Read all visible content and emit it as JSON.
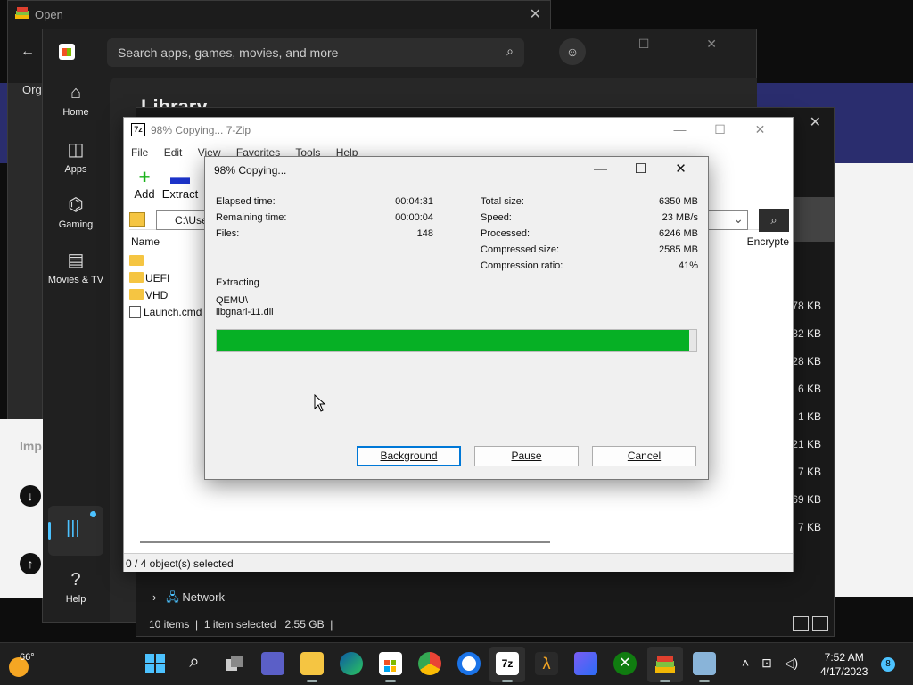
{
  "open_window": {
    "title": "Open",
    "org_label": "Orga"
  },
  "store": {
    "search_placeholder": "Search apps, games, movies, and more",
    "library_title": "Library",
    "nav": [
      {
        "label": "Home",
        "icon": "home-icon"
      },
      {
        "label": "Apps",
        "icon": "apps-icon"
      },
      {
        "label": "Gaming",
        "icon": "gaming-icon"
      },
      {
        "label": "Movies & TV",
        "icon": "movies-icon"
      },
      {
        "label": "Help",
        "icon": "help-icon"
      }
    ],
    "left_panel_label": "Imp"
  },
  "explorer": {
    "sizes": [
      "78 KB",
      "82 KB",
      "28 KB",
      "6 KB",
      "1 KB",
      "21 KB",
      "7 KB",
      "69 KB",
      "7 KB"
    ],
    "network_label": "Network",
    "status": {
      "items": "10 items",
      "selected": "1 item selected",
      "size": "2.55 GB"
    }
  },
  "zip": {
    "title": "98% Copying... 7-Zip",
    "menu": [
      "File",
      "Edit",
      "View",
      "Favorites",
      "Tools",
      "Help"
    ],
    "toolbar": {
      "add": "Add",
      "extract": "Extract"
    },
    "address": "C:\\Use",
    "columns": {
      "name": "Name",
      "encrypted": "Encrypte"
    },
    "files": [
      {
        "name": "",
        "type": "folder"
      },
      {
        "name": "UEFI",
        "type": "folder"
      },
      {
        "name": "VHD",
        "type": "folder"
      },
      {
        "name": "Launch.cmd",
        "type": "cmd"
      }
    ],
    "status": "0 / 4 object(s) selected"
  },
  "dialog": {
    "title": "98% Copying...",
    "left_stats": [
      {
        "label": "Elapsed time:",
        "value": "00:04:31"
      },
      {
        "label": "Remaining time:",
        "value": "00:00:04"
      },
      {
        "label": "Files:",
        "value": "148"
      }
    ],
    "right_stats": [
      {
        "label": "Total size:",
        "value": "6350 MB"
      },
      {
        "label": "Speed:",
        "value": "23 MB/s"
      },
      {
        "label": "Processed:",
        "value": "6246 MB"
      },
      {
        "label": "Compressed size:",
        "value": "2585 MB"
      },
      {
        "label": "Compression ratio:",
        "value": "41%"
      }
    ],
    "action": "Extracting",
    "path_dir": "QEMU\\",
    "path_file": "libgnarl-11.dll",
    "progress_fraction": 0.985,
    "buttons": {
      "background": "Background",
      "pause": "Pause",
      "cancel": "Cancel"
    }
  },
  "taskbar": {
    "temperature": "66°",
    "time": "7:52 AM",
    "date": "4/17/2023",
    "notifications": "8"
  }
}
